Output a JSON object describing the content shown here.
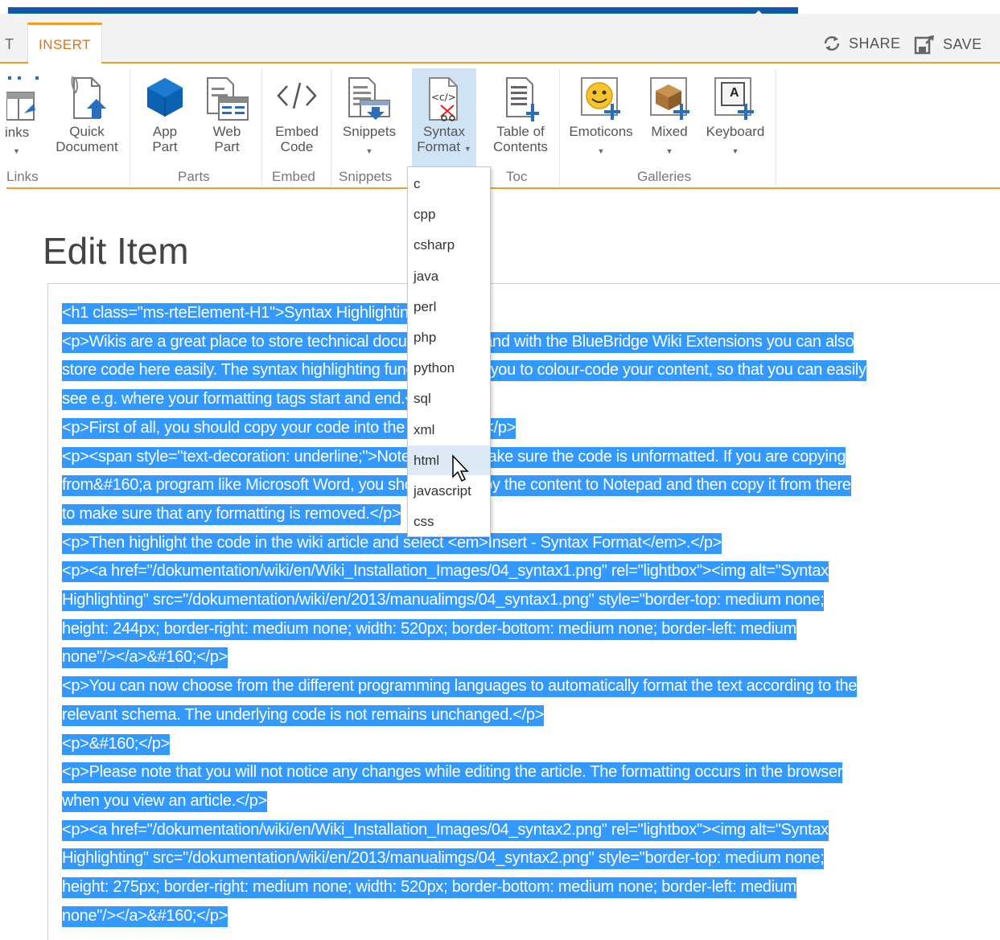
{
  "tabs": {
    "cut_label": "T",
    "active_label": "INSERT"
  },
  "actions": {
    "share_label": "SHARE",
    "save_label": "SAVE"
  },
  "ribbon": {
    "links": {
      "button_label": "inks",
      "group_label": "Links"
    },
    "quick_document": {
      "line1": "Quick",
      "line2": "Document"
    },
    "app_part": {
      "line1": "App",
      "line2": "Part"
    },
    "web_part": {
      "line1": "Web",
      "line2": "Part"
    },
    "parts_group_label": "Parts",
    "embed_code": {
      "line1": "Embed",
      "line2": "Code"
    },
    "embed_group_label": "Embed",
    "snippets": {
      "label": "Snippets",
      "group_label": "Snippets"
    },
    "syntax_format": {
      "line1": "Syntax",
      "line2": "Format"
    },
    "table_of_contents": {
      "line1": "Table of",
      "line2": "Contents"
    },
    "toc_group_label": "Toc",
    "emoticons": {
      "label": "Emoticons"
    },
    "mixed": {
      "label": "Mixed"
    },
    "keyboard": {
      "label": "Keyboard",
      "key_letter": "A"
    },
    "galleries_group_label": "Galleries"
  },
  "page": {
    "title": "Edit Item"
  },
  "syntax_dropdown": {
    "items": [
      "c",
      "cpp",
      "csharp",
      "java",
      "perl",
      "php",
      "python",
      "sql",
      "xml",
      "html",
      "javascript",
      "css"
    ],
    "hovered": "html"
  },
  "editor": {
    "lines": [
      "<h1 class=\"ms-rteElement-H1\">Syntax Highlighting</h1>",
      "<p>Wikis are a great place to store technical documentation, and with the BlueBridge Wiki Extensions you can also",
      "store code here easily. The syntax highlighting function allows you to colour-code your content, so that you can easily",
      "see e.g. where your formatting tags start and end.</p>",
      "<p>First of all, you should copy your code into the wiki article.</p>",
      "<p><span style=\"text-decoration: underline;\">Note</span>: Make sure the code is unformatted. If you are copying",
      "from&#160;a program like Microsoft Word, you should first copy the content to Notepad and then copy it from there",
      "to make sure that any formatting is removed.</p>",
      "<p>Then highlight the code in the wiki article and select <em>Insert - Syntax Format</em>.</p>",
      "<p><a href=\"/dokumentation/wiki/en/Wiki_Installation_Images/04_syntax1.png\" rel=\"lightbox\"><img alt=\"Syntax",
      "Highlighting\" src=\"/dokumentation/wiki/en/2013/manualimgs/04_syntax1.png\" style=\"border-top: medium none;",
      "height: 244px; border-right: medium none; width: 520px; border-bottom: medium none; border-left: medium",
      "none\"/></a>&#160;</p>",
      "<p>You can now choose from the different programming languages to automatically format the text according to the",
      "relevant schema. The underlying code is not remains unchanged.</p>",
      "<p>&#160;</p>",
      "<p>Please note that you will not notice any changes while editing the article. The formatting occurs in the browser",
      "when you view an article.</p>",
      "<p><a href=\"/dokumentation/wiki/en/Wiki_Installation_Images/04_syntax2.png\" rel=\"lightbox\"><img alt=\"Syntax",
      "Highlighting\" src=\"/dokumentation/wiki/en/2013/manualimgs/04_syntax2.png\" style=\"border-top: medium none;",
      "height: 275px; border-right: medium none; width: 520px; border-bottom: medium none; border-left: medium",
      "none\"/></a>&#160;</p>"
    ]
  },
  "colors": {
    "accent_orange": "#ef9e2e",
    "selection_blue": "#3399ff",
    "top_bar_blue": "#0f5aa8"
  }
}
